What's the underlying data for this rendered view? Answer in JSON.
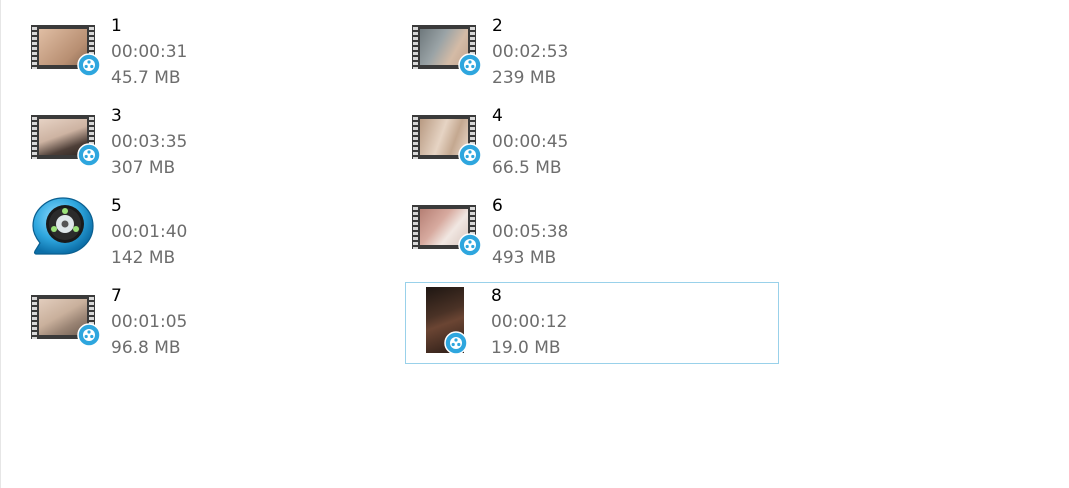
{
  "files": [
    {
      "name": "1",
      "duration": "00:00:31",
      "size": "45.7 MB",
      "thumb": "video-thumbnail",
      "colors": [
        "#d8b49a",
        "#b88f72"
      ]
    },
    {
      "name": "2",
      "duration": "00:02:53",
      "size": "239 MB",
      "thumb": "video-thumbnail",
      "colors": [
        "#7f8a8e",
        "#c9b29d"
      ]
    },
    {
      "name": "3",
      "duration": "00:03:35",
      "size": "307 MB",
      "thumb": "video-thumbnail",
      "colors": [
        "#d9c3b3",
        "#5a4a42"
      ]
    },
    {
      "name": "4",
      "duration": "00:00:45",
      "size": "66.5 MB",
      "thumb": "video-thumbnail",
      "colors": [
        "#c9b19c",
        "#e8d6c7"
      ]
    },
    {
      "name": "5",
      "duration": "00:01:40",
      "size": "142 MB",
      "thumb": "player-app-icon",
      "colors": [
        "#2ea6de",
        "#1c1c1c"
      ]
    },
    {
      "name": "6",
      "duration": "00:05:38",
      "size": "493 MB",
      "thumb": "video-thumbnail",
      "colors": [
        "#cfa49a",
        "#e9ded8"
      ]
    },
    {
      "name": "7",
      "duration": "00:01:05",
      "size": "96.8 MB",
      "thumb": "video-thumbnail",
      "colors": [
        "#d4bcaa",
        "#9a8474"
      ]
    },
    {
      "name": "8",
      "duration": "00:00:12",
      "size": "19.0 MB",
      "thumb": "video-thumbnail-portrait",
      "colors": [
        "#4a3226",
        "#1e1612"
      ],
      "selected": true
    }
  ],
  "badge_icon": "video-player-badge-icon",
  "accent": "#2ea6de",
  "selection_border": "#99d1ea"
}
